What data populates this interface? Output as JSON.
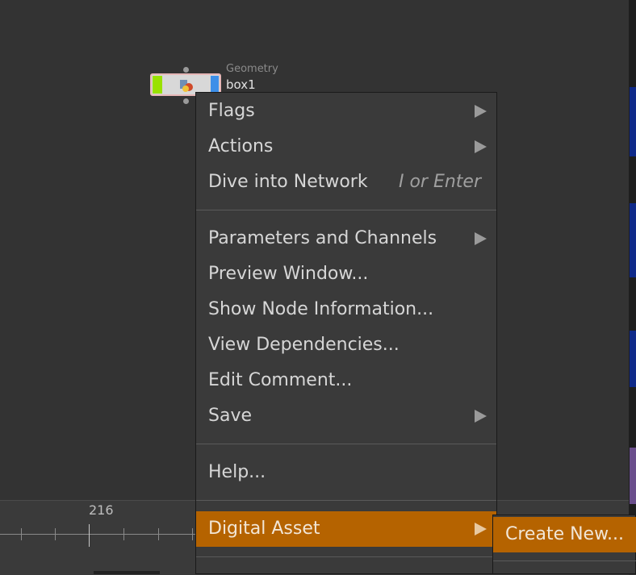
{
  "node": {
    "type_label": "Geometry",
    "name": "box1"
  },
  "timeline": {
    "frame_label": "216"
  },
  "context_menu": {
    "items": [
      {
        "label": "Flags",
        "submenu": true
      },
      {
        "label": "Actions",
        "submenu": true
      },
      {
        "label": "Dive into Network",
        "shortcut": "I or Enter"
      },
      {
        "label": "Parameters and Channels",
        "submenu": true
      },
      {
        "label": "Preview Window..."
      },
      {
        "label": "Show Node Information..."
      },
      {
        "label": "View Dependencies..."
      },
      {
        "label": "Edit Comment..."
      },
      {
        "label": "Save",
        "submenu": true
      },
      {
        "label": "Help..."
      },
      {
        "label": "Digital Asset",
        "submenu": true,
        "highlighted": true
      }
    ]
  },
  "submenu": {
    "items": [
      {
        "label": "Create New...",
        "highlighted": true
      }
    ]
  },
  "colors": {
    "highlight": "#b56300",
    "background": "#333333",
    "menu_bg": "#3a3a3a"
  }
}
